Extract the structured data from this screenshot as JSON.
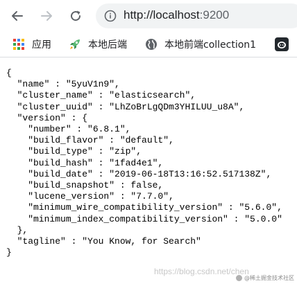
{
  "browser": {
    "url_scheme": "http://",
    "url_host": "localhost",
    "url_port": ":9200",
    "icons": {
      "back": "back-arrow-icon",
      "forward": "forward-arrow-icon",
      "reload": "reload-icon",
      "site_info": "info-icon"
    }
  },
  "bookmarks": [
    {
      "label": "应用",
      "icon": "apps-grid-icon"
    },
    {
      "label": "本地后端",
      "icon": "rocket-icon"
    },
    {
      "label": "本地前端collection1",
      "icon": "globe-icon"
    },
    {
      "label": "",
      "icon": "github-icon"
    }
  ],
  "json_lines": [
    "{",
    "  \"name\" : \"5yuV1n9\",",
    "  \"cluster_name\" : \"elasticsearch\",",
    "  \"cluster_uuid\" : \"LhZoBrLgQDm3YHILUU_u8A\",",
    "  \"version\" : {",
    "    \"number\" : \"6.8.1\",",
    "    \"build_flavor\" : \"default\",",
    "    \"build_type\" : \"zip\",",
    "    \"build_hash\" : \"1fad4e1\",",
    "    \"build_date\" : \"2019-06-18T13:16:52.517138Z\",",
    "    \"build_snapshot\" : false,",
    "    \"lucene_version\" : \"7.7.0\",",
    "    \"minimum_wire_compatibility_version\" : \"5.6.0\",",
    "    \"minimum_index_compatibility_version\" : \"5.0.0\"",
    "  },",
    "  \"tagline\" : \"You Know, for Search\"",
    "}"
  ],
  "watermark": {
    "url_text": "https://blog.csdn.net/chen",
    "tag_text": "@稀土掘金技术社区"
  },
  "colors": {
    "apps_red": "#ea4335",
    "apps_green": "#34a853",
    "apps_blue": "#4285f4",
    "apps_yellow": "#fbbc05",
    "rocket_green": "#5bb974"
  }
}
